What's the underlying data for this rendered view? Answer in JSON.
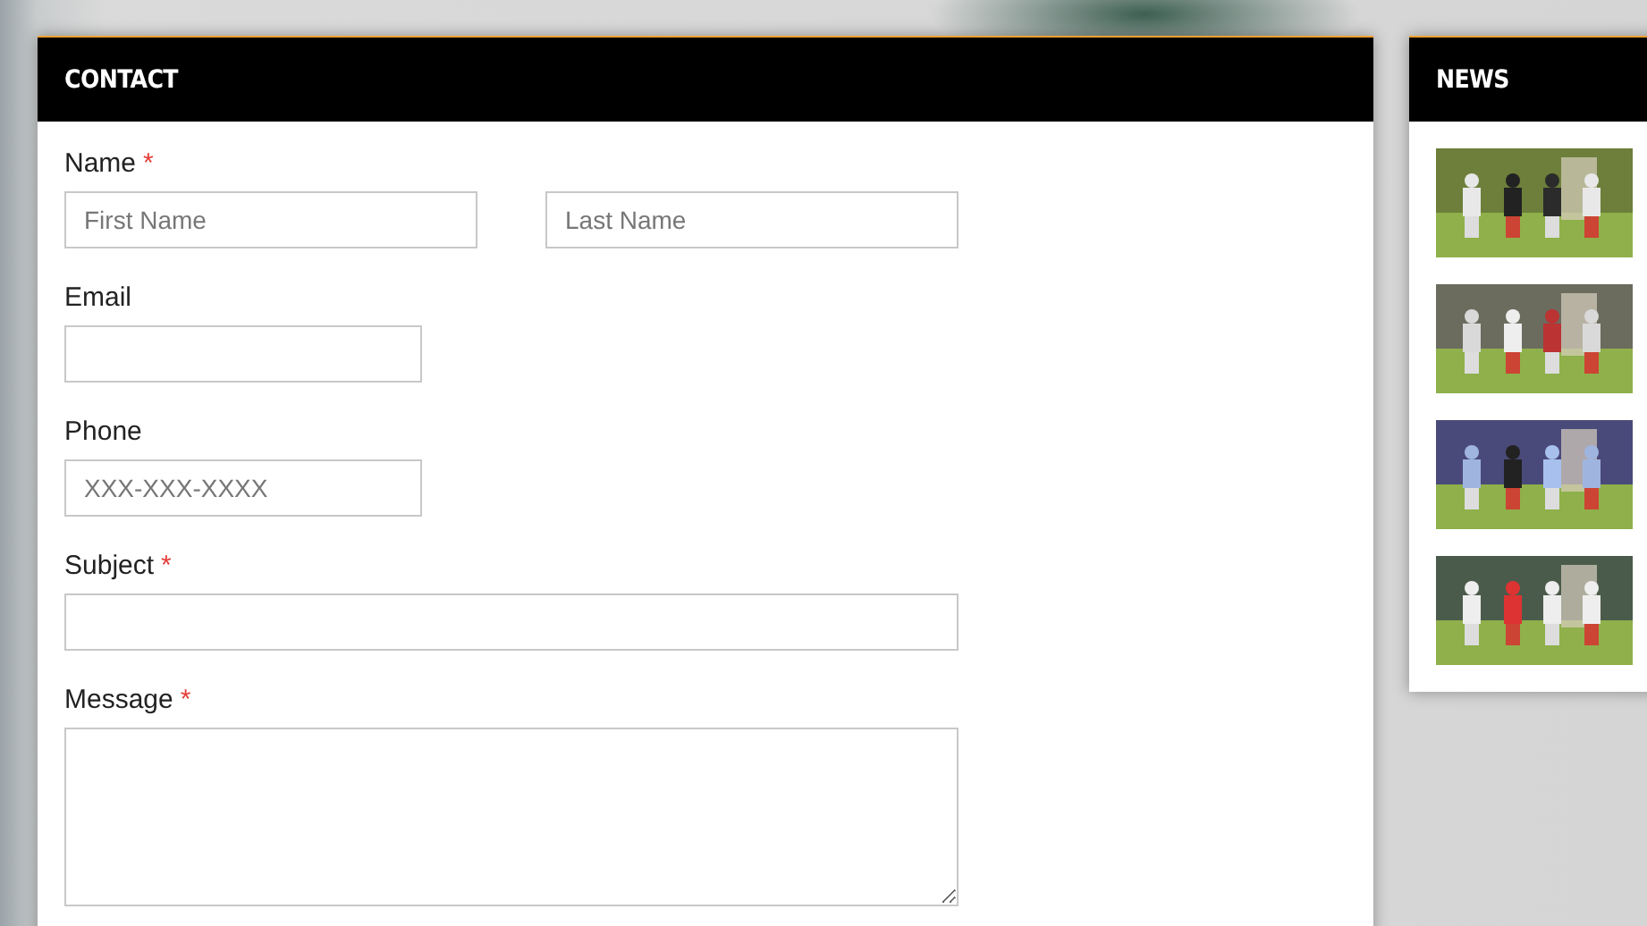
{
  "contact": {
    "title": "CONTACT",
    "fields": [
      {
        "kind": "name",
        "label": "Name",
        "required_mark": "*",
        "inputs": [
          {
            "placeholder": "First Name"
          },
          {
            "placeholder": "Last Name"
          }
        ]
      },
      {
        "kind": "short",
        "label": "Email"
      },
      {
        "kind": "short",
        "label": "Phone",
        "placeholder": "XXX-XXX-XXXX"
      },
      {
        "kind": "wide",
        "label": "Subject",
        "required_mark": "*"
      },
      {
        "kind": "textarea",
        "label": "Message",
        "required_mark": "*"
      }
    ]
  },
  "news": {
    "title": "NEWS"
  }
}
